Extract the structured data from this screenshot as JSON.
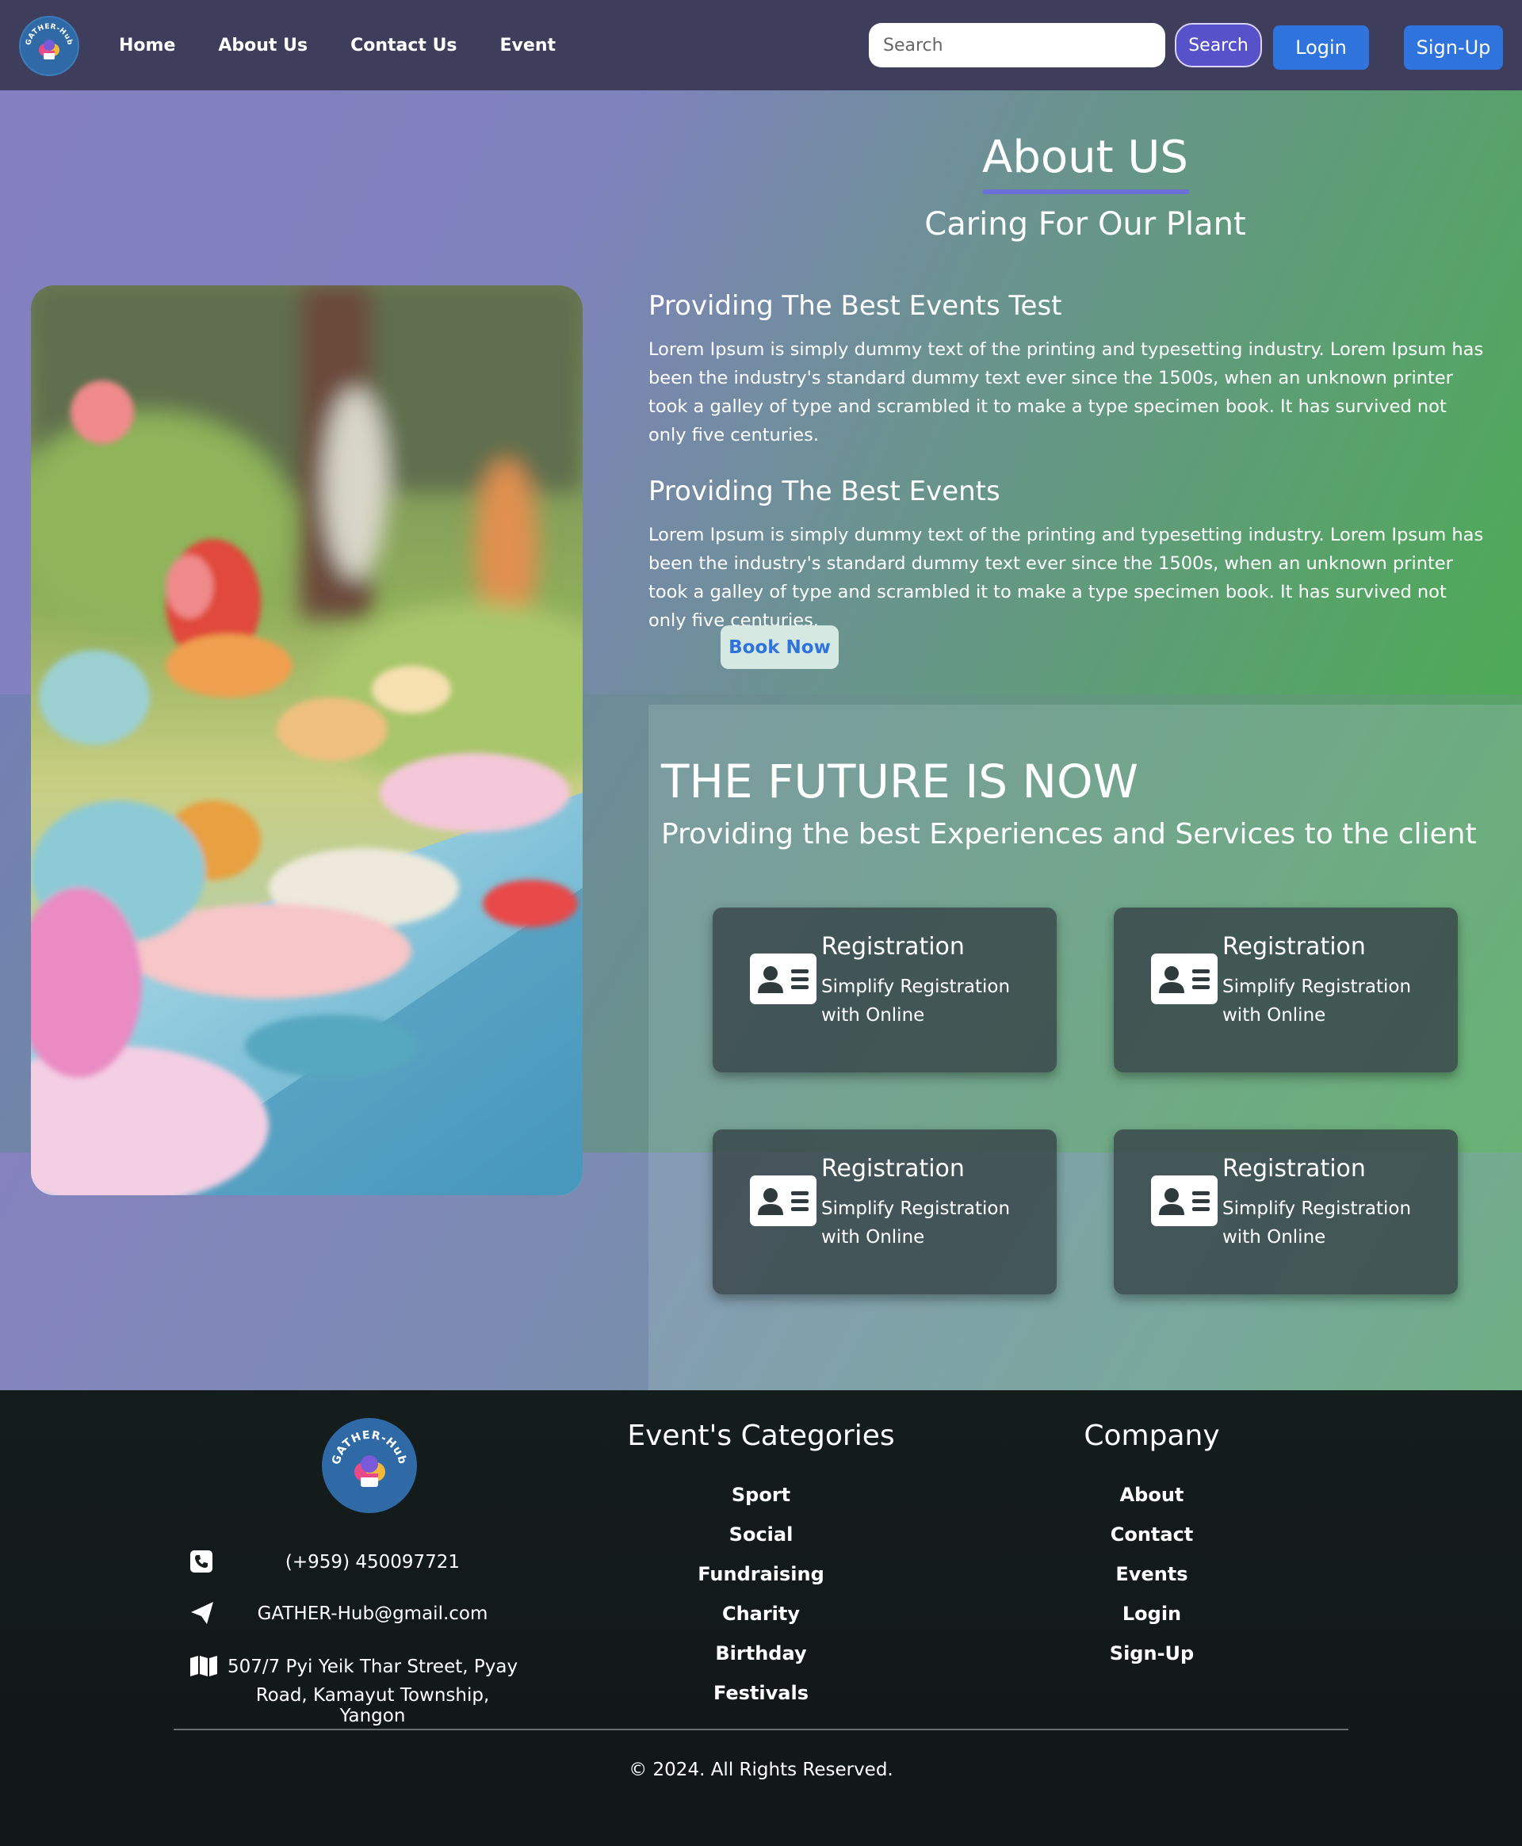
{
  "nav": {
    "logo_text": "GATHER-Hub",
    "links": [
      "Home",
      "About Us",
      "Contact Us",
      "Event"
    ],
    "search_placeholder": "Search",
    "search_button": "Search",
    "login": "Login",
    "signup": "Sign-Up"
  },
  "about": {
    "title": "About US",
    "subtitle": "Caring For Our Plant",
    "sections": [
      {
        "heading": "Providing The Best Events Test",
        "body": "Lorem Ipsum is simply dummy text of the printing and typesetting industry. Lorem Ipsum has been the industry's standard dummy text ever since the 1500s, when an unknown printer took a galley of type and scrambled it to make a type specimen book. It has survived not only five centuries."
      },
      {
        "heading": "Providing The Best Events",
        "body": "Lorem Ipsum is simply dummy text of the printing and typesetting industry. Lorem Ipsum has been the industry's standard dummy text ever since the 1500s, when an unknown printer took a galley of type and scrambled it to make a type specimen book. It has survived not only five centuries."
      }
    ],
    "book_button": "Book Now"
  },
  "future": {
    "title": "THE FUTURE IS NOW",
    "subtitle": "Providing the best Experiences and Services to the client",
    "cards": [
      {
        "title": "Registration",
        "desc": "Simplify Registration with Online",
        "icon": "id-card-icon"
      },
      {
        "title": "Registration",
        "desc": "Simplify Registration with Online",
        "icon": "id-card-icon"
      },
      {
        "title": "Registration",
        "desc": "Simplify Registration with Online",
        "icon": "id-card-icon"
      },
      {
        "title": "Registration",
        "desc": "Simplify Registration with Online",
        "icon": "id-card-icon"
      }
    ]
  },
  "footer": {
    "logo_text": "GATHER-Hub",
    "phone": "(+959) 450097721",
    "email": "GATHER-Hub@gmail.com",
    "address_line1": "507/7 Pyi Yeik Thar Street, Pyay",
    "address_line2": "Road, Kamayut Township, Yangon",
    "categories_heading": "Event's Categories",
    "categories": [
      "Sport",
      "Social",
      "Fundraising",
      "Charity",
      "Birthday",
      "Festivals"
    ],
    "company_heading": "Company",
    "company_links": [
      "About",
      "Contact",
      "Events",
      "Login",
      "Sign-Up"
    ],
    "copyright": "© 2024. All Rights Reserved."
  },
  "colors": {
    "nav_bg": "#3f3d5c",
    "accent_blue": "#2f73dc",
    "search_purple": "#5752c9",
    "footer_bg": "#141c1c"
  }
}
